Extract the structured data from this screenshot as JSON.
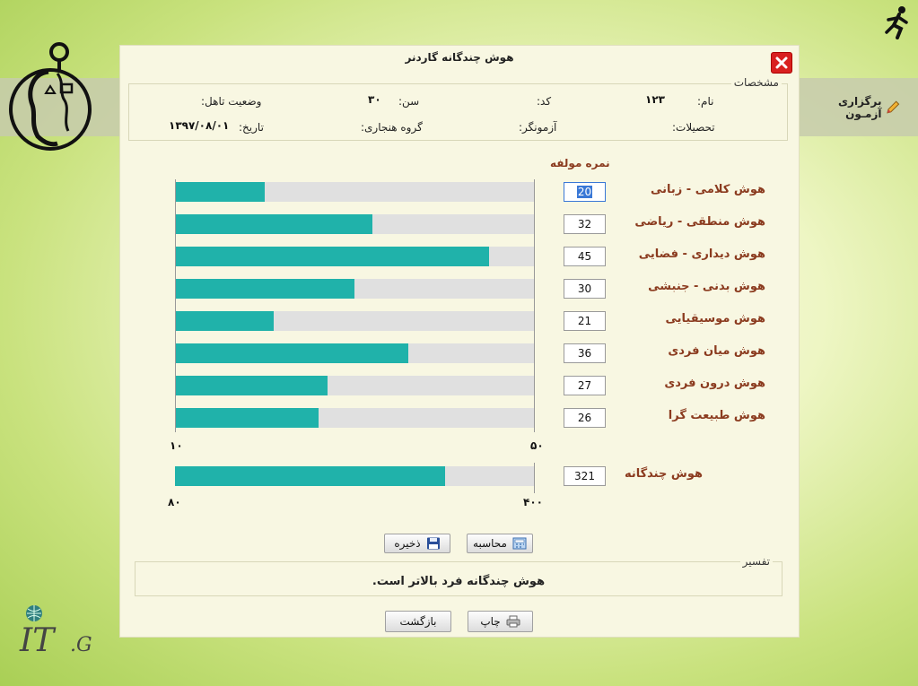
{
  "side_menu": {
    "test_administration": "برگزاری آزمـون"
  },
  "dialog": {
    "title": "هوش چندگانه گاردنر",
    "specs": {
      "legend": "مشخصات",
      "name_label": "نام:",
      "name_value": "۱۲۳",
      "code_label": "کد:",
      "code_value": "",
      "age_label": "سن:",
      "age_value": "۳۰",
      "marital_label": "وضعیت تاهل:",
      "marital_value": "",
      "education_label": "تحصیلات:",
      "education_value": "",
      "examiner_label": "آزمونگر:",
      "examiner_value": "",
      "norm_group_label": "گروه هنجاری:",
      "norm_group_value": "",
      "date_label": "تاریخ:",
      "date_value": "۱۳۹۷/۰۸/۰۱"
    },
    "scores": {
      "legend": "نمره مولفه",
      "min_label": "۱۰",
      "max_label": "۵۰",
      "total_label": "هوش چندگانه",
      "total_value": "321",
      "total_min": "۸۰",
      "total_max": "۴۰۰"
    },
    "buttons": {
      "save": "ذخیره",
      "calculate": "محاسبه",
      "print": "چاپ",
      "back": "بازگشت"
    },
    "interpretation": {
      "legend": "تفسیر",
      "text": "هوش چندگانه فرد بالاتر است."
    }
  },
  "chart_data": {
    "type": "bar",
    "orientation": "horizontal",
    "categories": [
      "هوش کلامی - زبانی",
      "هوش منطقی - ریاضی",
      "هوش دیداری - فضایی",
      "هوش بدنی - جنبشی",
      "هوش موسیقیایی",
      "هوش میان فردی",
      "هوش درون فردی",
      "هوش طبیعت گرا"
    ],
    "values": [
      20,
      32,
      45,
      30,
      21,
      36,
      27,
      26
    ],
    "xlim": [
      10,
      50
    ],
    "total": {
      "value": 321,
      "xlim": [
        80,
        400
      ]
    },
    "color": "#20b2aa",
    "track_color": "#e0e0e0"
  }
}
